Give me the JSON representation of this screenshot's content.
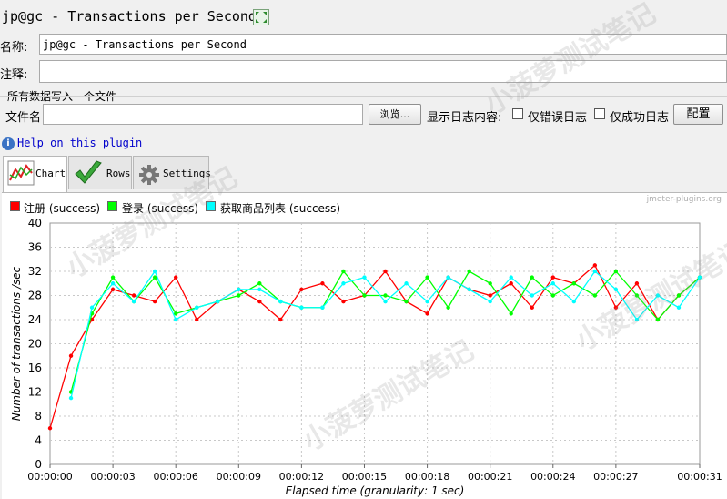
{
  "title": "jp@gc - Transactions per Second",
  "name_label": "名称:",
  "name_value": "jp@gc - Transactions per Second",
  "comment_label": "注释:",
  "comment_value": "",
  "file_section_title": "所有数据写入一个文件",
  "filename_label": "文件名",
  "filename_value": "",
  "browse_button": "浏览...",
  "log_label": "显示日志内容:",
  "errors_only_label": "仅错误日志",
  "success_only_label": "仅成功日志",
  "config_button": "配置",
  "help_link": "Help on this plugin",
  "tabs": [
    {
      "label": "Chart",
      "icon": "chart-icon",
      "active": true
    },
    {
      "label": "Rows",
      "icon": "checkmark-icon",
      "active": false
    },
    {
      "label": "Settings",
      "icon": "gear-icon",
      "active": false
    }
  ],
  "watermark_url": "jmeter-plugins.org",
  "watermark_text": "小菠萝测试笔记",
  "chart_data": {
    "type": "line",
    "title": "",
    "xlabel": "Elapsed time (granularity: 1 sec)",
    "ylabel": "Number of transactions /sec",
    "ylim": [
      0,
      40
    ],
    "yticks": [
      0,
      4,
      8,
      12,
      16,
      20,
      24,
      28,
      32,
      36,
      40
    ],
    "xlim": [
      0,
      31
    ],
    "xticks": [
      "00:00:00",
      "00:00:03",
      "00:00:06",
      "00:00:09",
      "00:00:12",
      "00:00:15",
      "00:00:18",
      "00:00:21",
      "00:00:24",
      "00:00:27",
      "00:00:31"
    ],
    "xtick_seconds": [
      0,
      3,
      6,
      9,
      12,
      15,
      18,
      21,
      24,
      27,
      31
    ],
    "grid": true,
    "legend": "top-left",
    "series": [
      {
        "name": "注册 (success)",
        "color": "#ff0000",
        "x": [
          0,
          1,
          2,
          3,
          4,
          5,
          6,
          7,
          8,
          9,
          10,
          11,
          12,
          13,
          14,
          15,
          16,
          17,
          18,
          19,
          20,
          21,
          22,
          23,
          24,
          25,
          26,
          27,
          28,
          29,
          30,
          31
        ],
        "values": [
          6,
          18,
          24,
          29,
          28,
          27,
          31,
          24,
          27,
          29,
          27,
          24,
          29,
          30,
          27,
          28,
          32,
          27,
          25,
          31,
          29,
          28,
          30,
          26,
          31,
          30,
          33,
          26,
          30,
          24,
          28,
          31
        ]
      },
      {
        "name": "登录 (success)",
        "color": "#00ff00",
        "x": [
          1,
          2,
          3,
          4,
          5,
          6,
          7,
          8,
          9,
          10,
          11,
          12,
          13,
          14,
          15,
          16,
          17,
          18,
          19,
          20,
          21,
          22,
          23,
          24,
          25,
          26,
          27,
          28,
          29,
          30,
          31
        ],
        "values": [
          12,
          25,
          31,
          27,
          31,
          25,
          26,
          27,
          28,
          30,
          27,
          26,
          26,
          32,
          28,
          28,
          27,
          31,
          26,
          32,
          30,
          25,
          31,
          28,
          30,
          28,
          32,
          28,
          24,
          28,
          31
        ]
      },
      {
        "name": "获取商品列表 (success)",
        "color": "#00ffff",
        "x": [
          1,
          2,
          3,
          4,
          5,
          6,
          7,
          8,
          9,
          10,
          11,
          12,
          13,
          14,
          15,
          16,
          17,
          18,
          19,
          20,
          21,
          22,
          23,
          24,
          25,
          26,
          27,
          28,
          29,
          30,
          31
        ],
        "values": [
          11,
          26,
          30,
          27,
          32,
          24,
          26,
          27,
          29,
          29,
          27,
          26,
          26,
          30,
          31,
          27,
          30,
          27,
          31,
          29,
          27,
          31,
          28,
          30,
          27,
          32,
          29,
          24,
          28,
          26,
          31
        ]
      }
    ]
  }
}
